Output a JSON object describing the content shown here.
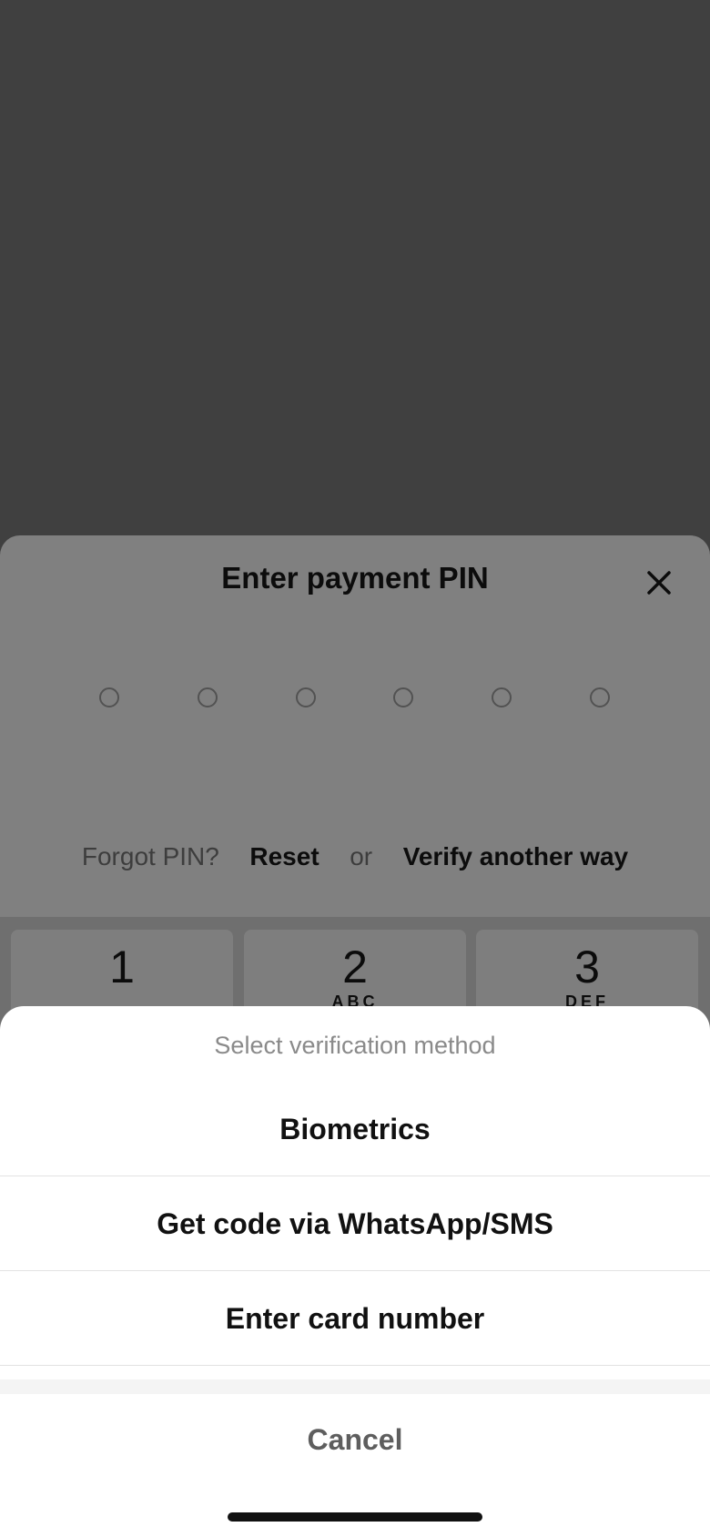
{
  "pin_sheet": {
    "title": "Enter payment PIN",
    "close_icon": "close-icon",
    "pin_length": 6,
    "forgot_label": "Forgot PIN?",
    "reset_label": "Reset",
    "or_label": "or",
    "verify_label": "Verify another way"
  },
  "keypad": {
    "keys": [
      {
        "digit": "1",
        "letters": ""
      },
      {
        "digit": "2",
        "letters": "ABC"
      },
      {
        "digit": "3",
        "letters": "DEF"
      }
    ]
  },
  "action_sheet": {
    "header": "Select verification method",
    "options": [
      {
        "label": "Biometrics"
      },
      {
        "label": "Get code via WhatsApp/SMS"
      },
      {
        "label": "Enter card number"
      }
    ],
    "cancel_label": "Cancel"
  },
  "colors": {
    "backdrop": "#404040",
    "sheet_dimmed": "#808080",
    "action_sheet_bg": "#ffffff",
    "cancel_text": "#5e5e5e"
  }
}
